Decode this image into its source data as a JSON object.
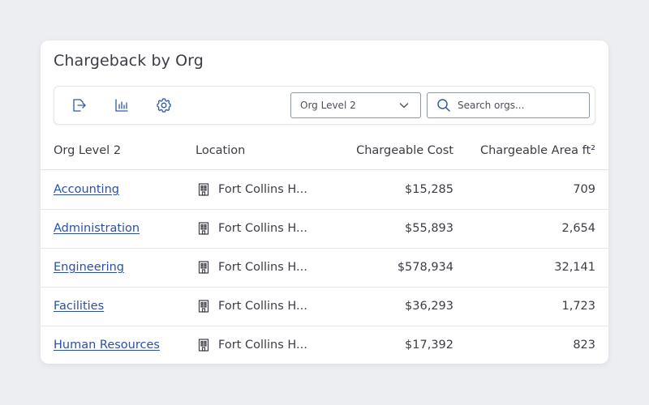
{
  "card": {
    "title": "Chargeback by Org"
  },
  "toolbar": {
    "icons": [
      "export-icon",
      "bar-chart-icon",
      "gear-icon"
    ],
    "select_value": "Org Level 2",
    "search_placeholder": "Search orgs..."
  },
  "table": {
    "headers": {
      "org": "Org Level 2",
      "location": "Location",
      "cost": "Chargeable Cost",
      "area": "Chargeable Area ft²"
    },
    "rows": [
      {
        "org": "Accounting",
        "location": "Fort Collins H...",
        "cost": "$15,285",
        "area": "709"
      },
      {
        "org": "Administration",
        "location": "Fort Collins H...",
        "cost": "$55,893",
        "area": "2,654"
      },
      {
        "org": "Engineering",
        "location": "Fort Collins H...",
        "cost": "$578,934",
        "area": "32,141"
      },
      {
        "org": "Facilities",
        "location": "Fort Collins H...",
        "cost": "$36,293",
        "area": "1,723"
      },
      {
        "org": "Human Resources",
        "location": "Fort Collins H...",
        "cost": "$17,392",
        "area": "823"
      }
    ]
  },
  "colors": {
    "background": "#eceef2",
    "link": "#2a4fa8",
    "icon": "#2f5aa8",
    "text": "#3a3d45"
  }
}
